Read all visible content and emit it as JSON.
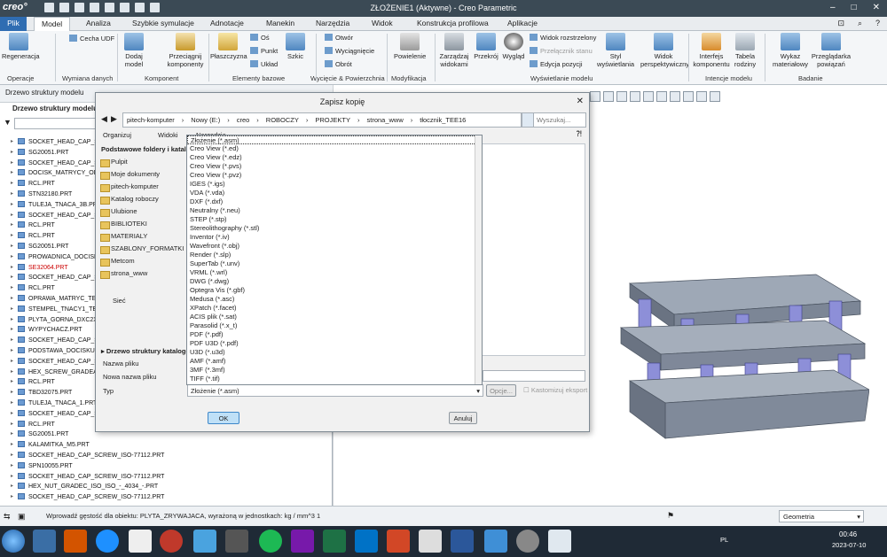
{
  "app": {
    "logo": "creo°",
    "window_title": "ZŁOŻENIE1 (Aktywne) - Creo Parametric"
  },
  "tabs": [
    "Plik",
    "Model",
    "Analiza",
    "Szybkie symulacje",
    "Adnotacje",
    "Manekin",
    "Narzędzia",
    "Widok",
    "Konstrukcja profilowa",
    "Aplikacje"
  ],
  "ribbon": {
    "buttons": {
      "regen": "Regeneracja",
      "cecha_udf": "Cecha UDF",
      "dodaj": "Dodaj model",
      "przeciagnij": "Przeciągnij komponenty",
      "plaszczyzna": "Płaszczyzna",
      "os": "Oś",
      "punkt": "Punkt",
      "uklad": "Układ",
      "szkic": "Szkic",
      "otwor": "Otwór",
      "wyciagniecie": "Wyciągnięcie",
      "obrot": "Obrót",
      "powielenie": "Powielenie",
      "zarzadzaj": "Zarządzaj widokami",
      "przekroj": "Przekrój",
      "wyglady": "Wygląd",
      "widok_rozstrz": "Widok rozstrzelony",
      "przelacznik": "Przełącznik stanu",
      "edycja": "Edycja pozycji",
      "styl": "Styl wyświetlania",
      "widok_persp": "Widok perspektywiczny",
      "interfejs": "Interfejs komponentu",
      "tabela": "Tabela rodziny",
      "wykaz": "Wykaz materiałowy",
      "przegladarka": "Przeglądarka powiązań"
    },
    "groups": [
      "Operacje",
      "Wymiana danych",
      "Komponent",
      "Elementy bazowe",
      "Wycięcie & Powierzchnia",
      "Modyfikacja",
      "Wyświetlanie modelu",
      "Intencje modelu",
      "Badanie"
    ]
  },
  "left_panel": {
    "tab_label": "Drzewo struktury modelu",
    "title": "Drzewo struktury modelu",
    "rows": [
      "SOCKET_HEAD_CAP_SC",
      "SG20051.PRT",
      "SOCKET_HEAD_CAP_SC",
      "DOCISK_MATRYCY_OD",
      "RCL.PRT",
      "STN32180.PRT",
      "TULEJA_TNACA_3B.PRT",
      "SOCKET_HEAD_CAP_SC",
      "RCL.PRT",
      "RCL.PRT",
      "SG20051.PRT",
      "PROWADNICA_DOCISK",
      "SE32064.PRT",
      "SOCKET_HEAD_CAP_SC",
      "RCL.PRT",
      "OPRAWA_MATRYC_TEE",
      "STEMPEL_TNACY1_TEE",
      "PLYTA_GORNA_DXC2X4",
      "WYPYCHACZ.PRT",
      "SOCKET_HEAD_CAP_SC",
      "PODSTAWA_DOCISKU",
      "SOCKET_HEAD_CAP_SC",
      "HEX_SCREW_GRADEAE",
      "RCL.PRT",
      "TBD32075.PRT",
      "TULEJA_TNACA_1.PRT",
      "SOCKET_HEAD_CAP_SC",
      "RCL.PRT",
      "SG20051.PRT",
      "KALAMITKA_M5.PRT",
      "SOCKET_HEAD_CAP_SCREW_ISO-77112.PRT",
      "SPN10055.PRT",
      "SOCKET_HEAD_CAP_SCREW_ISO-77112.PRT",
      "HEX_NUT_GRADEC_ISO_ISO_-_4034_-.PRT",
      "SOCKET_HEAD_CAP_SCREW_ISO-77112.PRT"
    ]
  },
  "dialog": {
    "title": "Zapisz kopię",
    "path": [
      "pitech-komputer",
      "Nowy (E:)",
      "creo",
      "ROBOCZY",
      "PROJEKTY",
      "strona_www",
      "tłocznik_TEE16"
    ],
    "search_placeholder": "Wyszukaj...",
    "toolbar": [
      "Organizuj",
      "Widoki",
      "Narzędzia"
    ],
    "side_header": "Podstawowe foldery i katalogi",
    "side_items": [
      "Pulpit",
      "Moje dokumenty",
      "pitech-komputer",
      "Katalog roboczy",
      "Ulubione",
      "BIBLIOTEKI",
      "MATERIALY",
      "SZABLONY_FORMATKI",
      "Metcom",
      "strona_www"
    ],
    "network": "Sieć",
    "tree_section": "Drzewo struktury katalogów",
    "name_label": "Nazwa pliku",
    "new_name_label": "Nowa nazwa pliku",
    "type_label": "Typ",
    "type_value": "Złożenie (*.asm)",
    "options_button": "Opcje...",
    "customize_label": "Kastomizuj eksport",
    "ok": "OK",
    "cancel": "Anuluj",
    "types": [
      "Złożenie (*.asm)",
      "Creo View (*.ed)",
      "Creo View (*.edz)",
      "Creo View (*.pvs)",
      "Creo View (*.pvz)",
      "IGES (*.igs)",
      "VDA (*.vda)",
      "DXF (*.dxf)",
      "Neutralny (*.neu)",
      "STEP (*.stp)",
      "Stereolithography (*.stl)",
      "Inventor (*.iv)",
      "Wavefront (*.obj)",
      "Render (*.slp)",
      "SuperTab (*.unv)",
      "VRML (*.wrl)",
      "DWG (*.dwg)",
      "Optegra Vis (*.gbf)",
      "Medusa (*.asc)",
      "XPatch (*.facet)",
      "ACIS plik (*.sat)",
      "Parasolid (*.x_t)",
      "PDF (*.pdf)",
      "PDF U3D (*.pdf)",
      "U3D (*.u3d)",
      "AMF (*.amf)",
      "3MF (*.3mf)",
      "TIFF (*.tif)"
    ]
  },
  "status": {
    "message": "Wprowadź gęstość dla obiektu: PLYTA_ZRYWAJACA, wyrażoną w jednostkach: kg / mm^3  1",
    "filter": "Geometria"
  },
  "taskbar": {
    "lang": "PL",
    "time": "00:46",
    "date": "2023-07-10"
  }
}
